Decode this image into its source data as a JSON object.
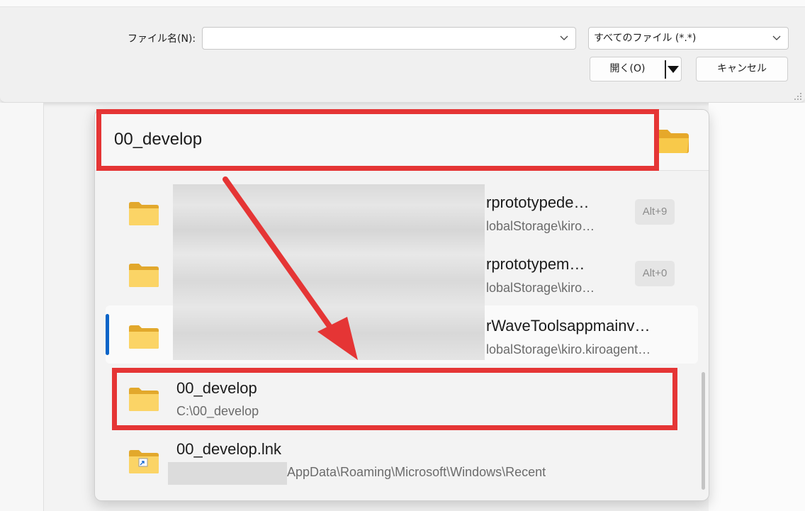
{
  "dialog": {
    "filename_label": "ファイル名(N):",
    "filename_value": "",
    "filetype_value": "すべてのファイル (*.*)",
    "open_label": "開く(O)",
    "cancel_label": "キャンセル"
  },
  "popup": {
    "query": "00_develop",
    "results": [
      {
        "name": "rprototypede…",
        "path": "lobalStorage\\kiro…",
        "shortcut": "Alt+9"
      },
      {
        "name": "rprototypem…",
        "path": "lobalStorage\\kiro…",
        "shortcut": "Alt+0"
      },
      {
        "name": "rWaveToolsappmainv…",
        "path": "lobalStorage\\kiro.kiroagent…",
        "shortcut": ""
      },
      {
        "name": "00_develop",
        "path": "C:\\00_develop",
        "shortcut": ""
      },
      {
        "name": "00_develop.lnk",
        "path": "AppData\\Roaming\\Microsoft\\Windows\\Recent",
        "shortcut": ""
      }
    ]
  },
  "colors": {
    "annotation": "#e53535",
    "selection_accent": "#0a64c8",
    "folder_yellow": "#f7c94b"
  },
  "icons": {
    "folder": "folder-icon",
    "shortcut_folder": "folder-shortcut-icon",
    "chevron": "chevron-down-icon"
  }
}
